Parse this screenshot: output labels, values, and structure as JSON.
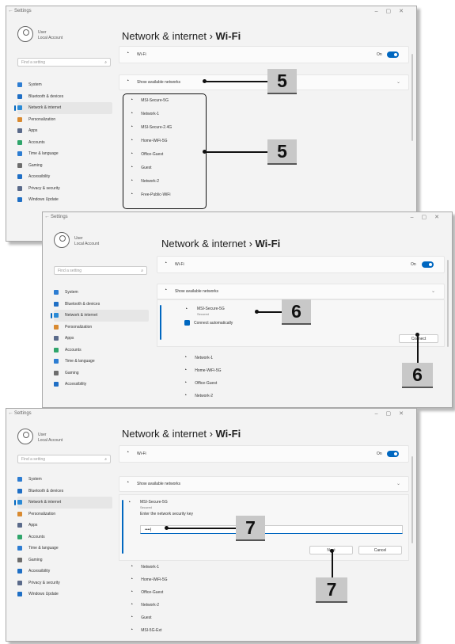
{
  "app": {
    "title": "Settings",
    "user_name": "User",
    "user_sub": "Local Account",
    "search_placeholder": "Find a setting"
  },
  "header": {
    "prefix": "Network & internet",
    "sep": "›",
    "current": "Wi-Fi"
  },
  "nav_items": [
    "System",
    "Bluetooth & devices",
    "Network & internet",
    "Personalization",
    "Apps",
    "Accounts",
    "Time & language",
    "Gaming",
    "Accessibility",
    "Privacy & security",
    "Windows Update"
  ],
  "wifi_row": {
    "label": "Wi-Fi",
    "state": "On"
  },
  "show_networks_label": "Show available networks",
  "networks": [
    "MSI-Secure-5G",
    "Network-1",
    "MSI-Secure-2.4G",
    "Home-WiFi-5G",
    "Office-Guest",
    "Guest",
    "Network-2",
    "Free-Public-WiFi"
  ],
  "panel2": {
    "expanded_network": "MSI-Secure-5G",
    "expanded_sub": "Secured",
    "auto_connect_label": "Connect automatically",
    "connect_button": "Connect",
    "other_networks": [
      "Network-1",
      "Home-WiFi-5G",
      "Office-Guest",
      "Network-2"
    ]
  },
  "panel3": {
    "expanded_network": "MSI-Secure-5G",
    "expanded_sub": "Secured",
    "prompt": "Enter the network security key",
    "password_value": "••••|",
    "next_button": "Next",
    "cancel_button": "Cancel",
    "other_networks": [
      "Network-1",
      "Home-WiFi-5G",
      "Office-Guest",
      "Network-2",
      "Guest",
      "MSI-5G-Ext"
    ]
  },
  "callouts": {
    "step5": "5",
    "step6": "6",
    "step7": "7"
  },
  "colors": {
    "accent": "#0067c0",
    "callout_bg": "#c8c8c8"
  }
}
